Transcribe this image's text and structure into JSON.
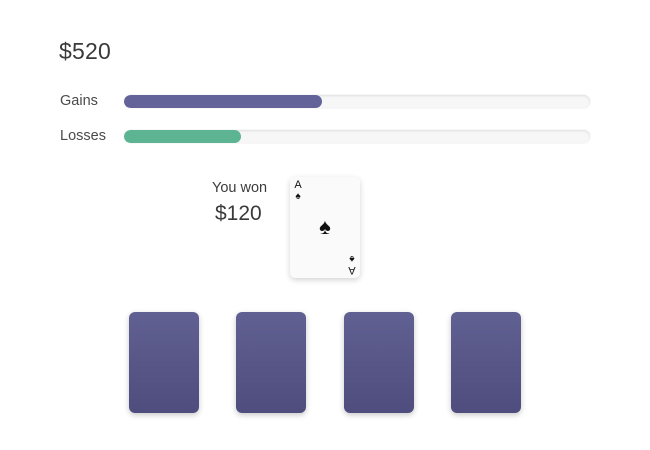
{
  "balance": "$520",
  "stats": {
    "gains": {
      "label": "Gains",
      "fraction": 0.425,
      "color": "#636399"
    },
    "losses": {
      "label": "Losses",
      "fraction": 0.25,
      "color": "#5cb493"
    }
  },
  "result": {
    "message": "You won",
    "amount": "$120"
  },
  "revealed_card": {
    "rank": "A",
    "suit_icon": "spade-icon",
    "suit_glyph": "♠"
  },
  "card_backs": {
    "count": 4,
    "color": "#58578a"
  }
}
